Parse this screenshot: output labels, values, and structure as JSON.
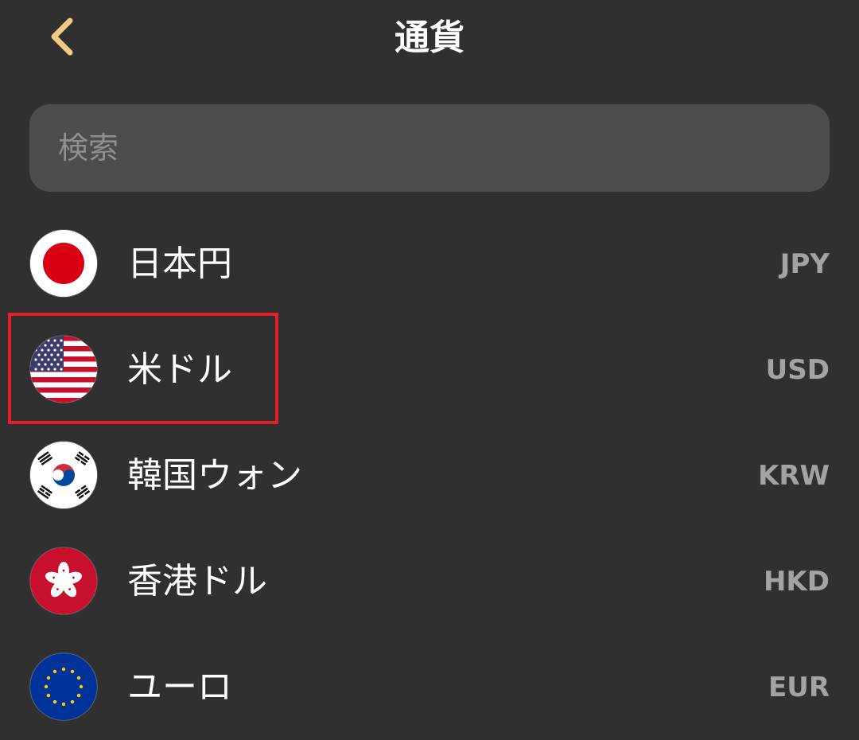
{
  "header": {
    "title": "通貨",
    "back_icon": "chevron-left-icon",
    "back_icon_color": "#f5c985"
  },
  "search": {
    "placeholder": "検索",
    "value": ""
  },
  "currencies": [
    {
      "name": "日本円",
      "code": "JPY",
      "flag_icon": "japan-flag-icon"
    },
    {
      "name": "米ドル",
      "code": "USD",
      "flag_icon": "us-flag-icon"
    },
    {
      "name": "韓国ウォン",
      "code": "KRW",
      "flag_icon": "south-korea-flag-icon"
    },
    {
      "name": "香港ドル",
      "code": "HKD",
      "flag_icon": "hong-kong-flag-icon"
    },
    {
      "name": "ユーロ",
      "code": "EUR",
      "flag_icon": "eu-flag-icon"
    }
  ],
  "colors": {
    "background": "#303030",
    "search_background": "#4d4d4d",
    "code_text": "#a3a3a3",
    "highlight_border": "#e3202a"
  }
}
